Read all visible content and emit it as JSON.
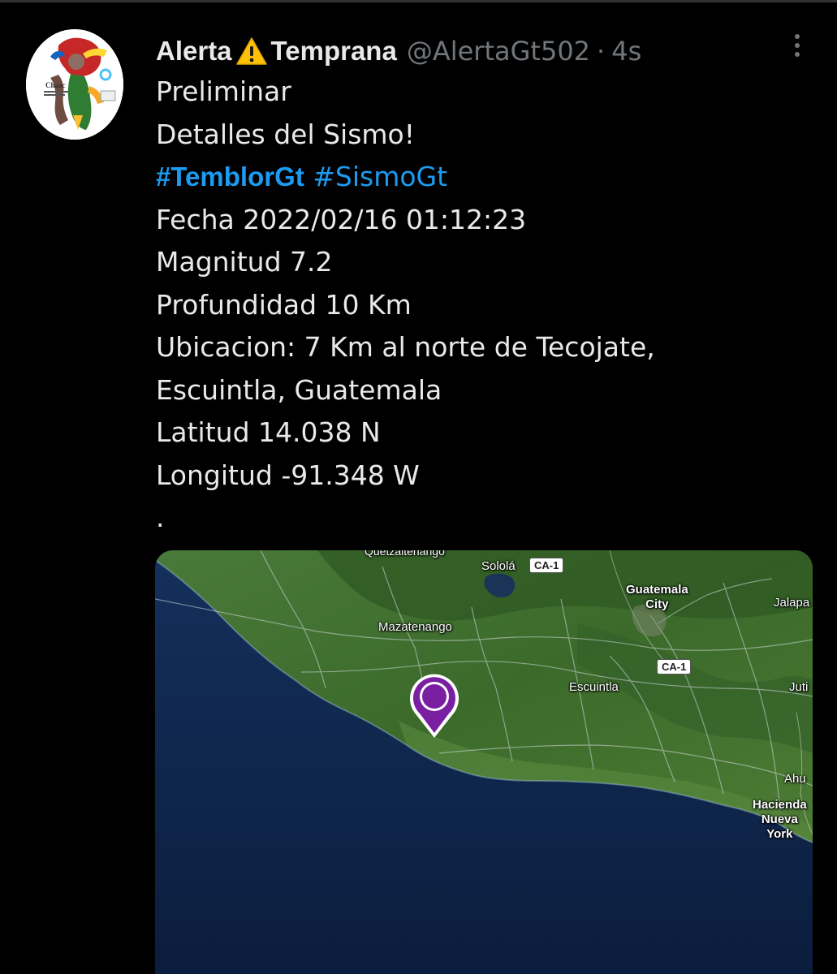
{
  "tweet": {
    "display_name_part1": "Alerta",
    "display_name_part2": "Temprana",
    "name_icon": "warning-icon",
    "handle": "@AlertaGt502",
    "separator": "·",
    "timestamp": "4s",
    "avatar_text": "Chaac",
    "more_icon": "more-vertical-icon",
    "lines": {
      "l1": "Preliminar",
      "l2": "Detalles del Sismo!",
      "hashtag1": "#TemblorGt",
      "hashtag2": "#SismoGt",
      "l4": "Fecha 2022/02/16 01:12:23",
      "l5": "Magnitud 7.2",
      "l6": "Profundidad 10 Km",
      "l7": "Ubicacion: 7 Km al norte de Tecojate,",
      "l8": "Escuintla, Guatemala",
      "l9": "Latitud 14.038 N",
      "l10": "Longitud -91.348 W",
      "l11": "."
    }
  },
  "map": {
    "marker_icon": "map-pin-icon",
    "labels": {
      "quetzaltenango": "Quetzaltenango",
      "solola": "Sololá",
      "ca1_a": "CA-1",
      "guatemala_city_1": "Guatemala",
      "guatemala_city_2": "City",
      "jalapa": "Jalapa",
      "mazatenango": "Mazatenango",
      "ca1_b": "CA-1",
      "escuintla": "Escuintla",
      "jutiapa": "Juti",
      "ahuachapan": "Ahu",
      "hacienda_1": "Hacienda",
      "hacienda_2": "Nueva",
      "hacienda_3": "York"
    },
    "colors": {
      "land": "#3d6a2c",
      "sea": "#0e2447",
      "marker": "#7b1fa2"
    }
  },
  "colors": {
    "background": "#000000",
    "text": "#e7e9ea",
    "secondary": "#71767b",
    "link": "#1d9bf0"
  }
}
